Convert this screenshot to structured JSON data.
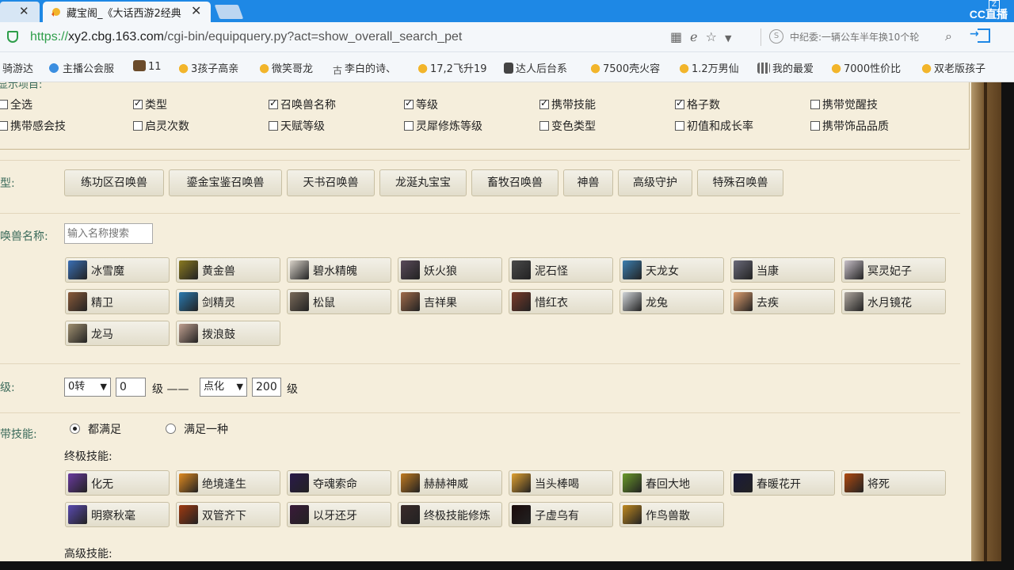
{
  "browser": {
    "prev_tab_close": "✕",
    "active_tab_title": "藏宝阁_《大话西游2经典",
    "active_tab_close": "✕",
    "url_protocol": "https://",
    "url_host": "xy2.cbg.163.com",
    "url_path": "/cgi-bin/equipquery.py?act=show_overall_search_pet",
    "search_placeholder": "中纪委:一辆公车半年换10个轮",
    "overlay_logo": "CC直播",
    "overlay_badge": "Z"
  },
  "bookmarks": [
    {
      "label": "骑游达",
      "icon": "none"
    },
    {
      "label": "主播公会服",
      "icon": "globe-icon"
    },
    {
      "label": "11",
      "icon": "image-icon"
    },
    {
      "label": "3孩子高亲",
      "icon": "chick-icon"
    },
    {
      "label": "微笑哥龙",
      "icon": "chick-icon"
    },
    {
      "label": "李白的诗、",
      "icon": "gu-icon"
    },
    {
      "label": "17,2飞升19",
      "icon": "chick-icon"
    },
    {
      "label": "达人后台系",
      "icon": "doc-icon"
    },
    {
      "label": "7500壳火容",
      "icon": "chick-icon"
    },
    {
      "label": "1.2万男仙",
      "icon": "chick-icon"
    },
    {
      "label": "我的最爱",
      "icon": "grid-icon"
    },
    {
      "label": "7000性价比",
      "icon": "chick-icon"
    },
    {
      "label": "双老版孩子",
      "icon": "chick-icon"
    }
  ],
  "display_options": {
    "legend": "显示项目:",
    "items": [
      {
        "label": "全选",
        "checked": false
      },
      {
        "label": "类型",
        "checked": true
      },
      {
        "label": "召唤兽名称",
        "checked": true
      },
      {
        "label": "等级",
        "checked": true
      },
      {
        "label": "携带技能",
        "checked": true
      },
      {
        "label": "格子数",
        "checked": true
      },
      {
        "label": "携带觉醒技",
        "checked": false
      },
      {
        "label": "携带感会技",
        "checked": false
      },
      {
        "label": "启灵次数",
        "checked": false
      },
      {
        "label": "天赋等级",
        "checked": false
      },
      {
        "label": "灵犀修炼等级",
        "checked": false
      },
      {
        "label": "变色类型",
        "checked": false
      },
      {
        "label": "初值和成长率",
        "checked": false
      },
      {
        "label": "携带饰品品质",
        "checked": false
      }
    ]
  },
  "type_filter": {
    "label": "型:",
    "options": [
      "练功区召唤兽",
      "鎏金宝鉴召唤兽",
      "天书召唤兽",
      "龙涎丸宝宝",
      "畜牧召唤兽",
      "神兽",
      "高级守护",
      "特殊召唤兽"
    ]
  },
  "name_filter": {
    "label": "唤兽名称:",
    "placeholder": "输入名称搜索",
    "pets": [
      {
        "name": "冰雪魔",
        "color": "#3a6fb5"
      },
      {
        "name": "黄金兽",
        "color": "#8a7a20"
      },
      {
        "name": "碧水精魄",
        "color": "#d8d2c8"
      },
      {
        "name": "妖火狼",
        "color": "#5a4a5a"
      },
      {
        "name": "泥石怪",
        "color": "#4a4a4a"
      },
      {
        "name": "天龙女",
        "color": "#3c7fb0"
      },
      {
        "name": "当康",
        "color": "#6a6a7a"
      },
      {
        "name": "冥灵妃子",
        "color": "#c8c0c8"
      },
      {
        "name": "精卫",
        "color": "#8a5a3a"
      },
      {
        "name": "剑精灵",
        "color": "#2a7ab0"
      },
      {
        "name": "松鼠",
        "color": "#7a6a5a"
      },
      {
        "name": "吉祥果",
        "color": "#a06a4a"
      },
      {
        "name": "惜红衣",
        "color": "#7a3a2a"
      },
      {
        "name": "龙兔",
        "color": "#d0d4d8"
      },
      {
        "name": "去疾",
        "color": "#e0a070"
      },
      {
        "name": "水月镜花",
        "color": "#b0a8a0"
      },
      {
        "name": "龙马",
        "color": "#a09070"
      },
      {
        "name": "拨浪鼓",
        "color": "#c0a090"
      }
    ]
  },
  "level_filter": {
    "label": "级:",
    "min_turn": "0转",
    "min_level": "0",
    "unit1": "级 ——",
    "max_turn": "点化",
    "max_level": "200",
    "unit2": "级"
  },
  "skill_filter": {
    "label": "带技能:",
    "mode_all": "都满足",
    "mode_any": "满足一种",
    "ultimate_label": "终极技能:",
    "ultimate_skills": [
      {
        "name": "化无",
        "color": "#6a3aa0"
      },
      {
        "name": "绝境逢生",
        "color": "#e08a20"
      },
      {
        "name": "夺魂索命",
        "color": "#2a1a4a"
      },
      {
        "name": "赫赫神威",
        "color": "#c07a20"
      },
      {
        "name": "当头棒喝",
        "color": "#e0a030"
      },
      {
        "name": "春回大地",
        "color": "#6a9a2a"
      },
      {
        "name": "春暖花开",
        "color": "#1a1a3a"
      },
      {
        "name": "将死",
        "color": "#b04a10"
      },
      {
        "name": "明察秋毫",
        "color": "#5a4ab0"
      },
      {
        "name": "双管齐下",
        "color": "#a03a10"
      },
      {
        "name": "以牙还牙",
        "color": "#3a1a3a"
      },
      {
        "name": "终极技能修炼",
        "color": "#3a2a2a"
      },
      {
        "name": "子虚乌有",
        "color": "#1a0a0a"
      },
      {
        "name": "作鸟兽散",
        "color": "#c08a20"
      }
    ],
    "advanced_label": "高级技能:"
  }
}
